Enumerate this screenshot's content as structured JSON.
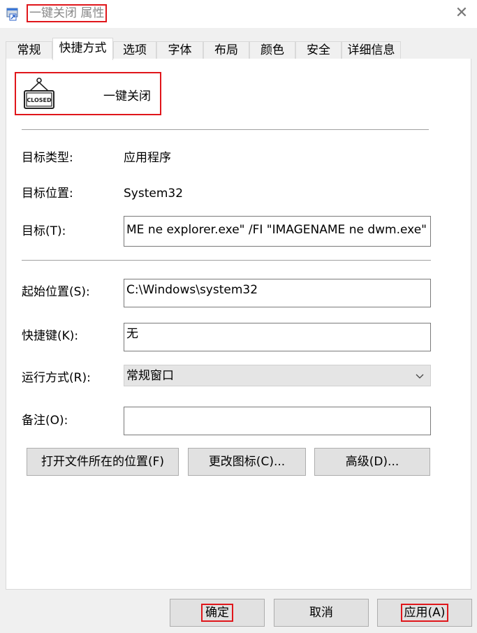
{
  "window": {
    "title": "一键关闭 属性",
    "close_glyph": "✕"
  },
  "tabs": [
    {
      "label": "常规"
    },
    {
      "label": "快捷方式"
    },
    {
      "label": "选项"
    },
    {
      "label": "字体"
    },
    {
      "label": "布局"
    },
    {
      "label": "颜色"
    },
    {
      "label": "安全"
    },
    {
      "label": "详细信息"
    }
  ],
  "shortcut": {
    "icon_text": "CLOSED",
    "name": "一键关闭",
    "target_type_label": "目标类型:",
    "target_type_value": "应用程序",
    "target_location_label": "目标位置:",
    "target_location_value": "System32",
    "target_label": "目标(T):",
    "target_value": "ME ne explorer.exe\" /FI \"IMAGENAME ne dwm.exe\"",
    "start_in_label": "起始位置(S):",
    "start_in_value": "C:\\Windows\\system32",
    "hotkey_label": "快捷键(K):",
    "hotkey_value": "无",
    "run_label": "运行方式(R):",
    "run_value": "常规窗口",
    "comment_label": "备注(O):",
    "comment_value": "",
    "open_location_button": "打开文件所在的位置(F)",
    "change_icon_button": "更改图标(C)...",
    "advanced_button": "高级(D)..."
  },
  "footer": {
    "ok": "确定",
    "cancel": "取消",
    "apply": "应用(A)"
  }
}
